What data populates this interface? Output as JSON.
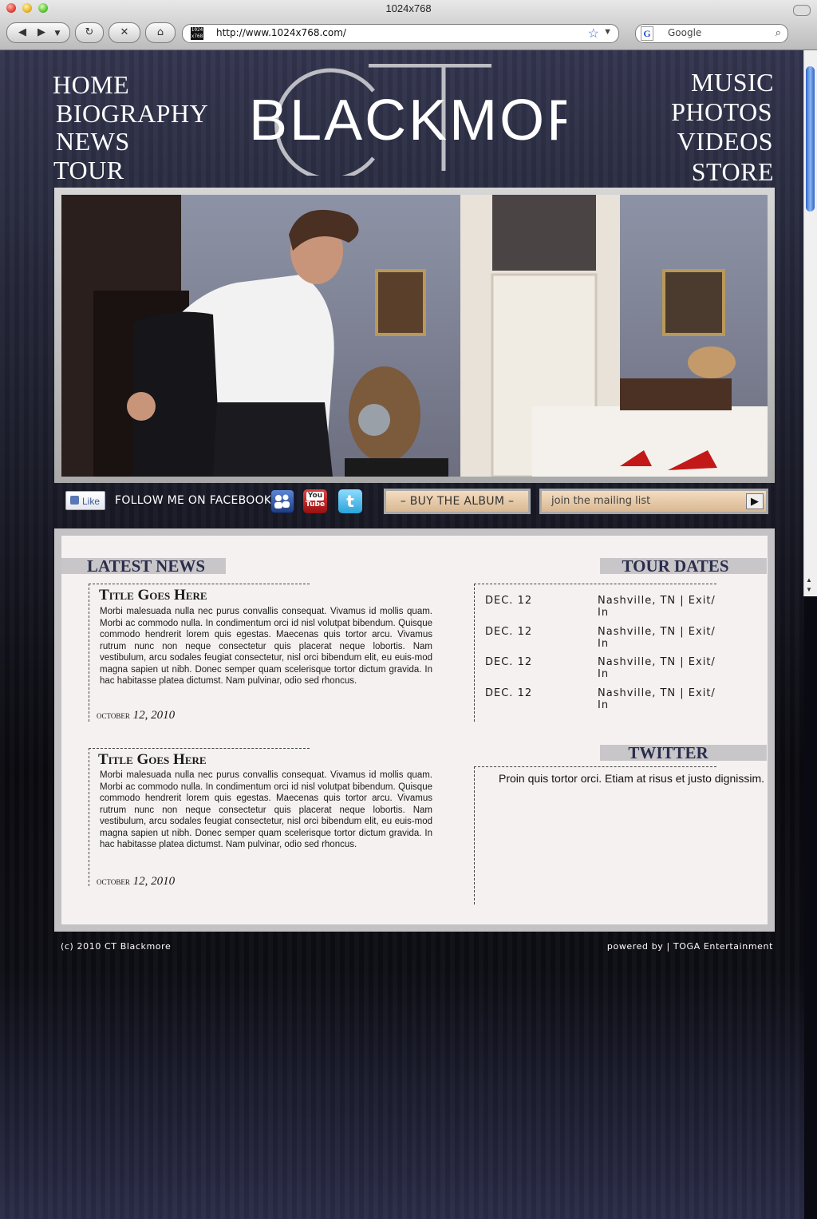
{
  "browser": {
    "window_title": "1024x768",
    "url": "http://www.1024x768.com/",
    "favicon_text": "1024 x768",
    "search_engine": "Google",
    "search_placeholder": "Google"
  },
  "nav": {
    "left": [
      "HOME",
      "BIOGRAPHY",
      "NEWS",
      "TOUR"
    ],
    "right": [
      "MUSIC",
      "PHOTOS",
      "VIDEOS",
      "STORE"
    ]
  },
  "logo": {
    "initials": "CT",
    "name": "BLACKMORE"
  },
  "social": {
    "like_label": "Like",
    "follow_text": "FOLLOW ME ON FACEBOOK",
    "youtube_label_top": "You",
    "youtube_label_bottom": "Tube",
    "album_button": "– BUY THE ALBUM –",
    "mailing_placeholder": "join the mailing list"
  },
  "news": {
    "heading": "LATEST NEWS",
    "posts": [
      {
        "title": "Title Goes Here",
        "body": "Morbi malesuada nulla nec purus convallis consequat. Vivamus id mollis quam. Morbi ac commodo nulla. In condimentum orci id nisl volutpat bibendum. Quisque commodo hendrerit lorem quis egestas. Maecenas quis tortor arcu. Vivamus rutrum nunc non neque consectetur quis placerat neque lobortis. Nam vestibulum, arcu sodales feugiat consectetur, nisl orci bibendum elit, eu euis-mod magna sapien ut nibh. Donec semper quam scelerisque tortor dictum gravida. In hac habitasse platea dictumst. Nam pulvinar, odio sed rhoncus.",
        "date_month": "october",
        "date_rest": "12, 2010"
      },
      {
        "title": "Title Goes Here",
        "body": "Morbi malesuada nulla nec purus convallis consequat. Vivamus id mollis quam. Morbi ac commodo nulla. In condimentum orci id nisl volutpat bibendum. Quisque commodo hendrerit lorem quis egestas. Maecenas quis tortor arcu. Vivamus rutrum nunc non neque consectetur quis placerat neque lobortis. Nam vestibulum, arcu sodales feugiat consectetur, nisl orci bibendum elit, eu euis-mod magna sapien ut nibh. Donec semper quam scelerisque tortor dictum gravida. In hac habitasse platea dictumst. Nam pulvinar, odio sed rhoncus.",
        "date_month": "october",
        "date_rest": "12, 2010"
      }
    ]
  },
  "tour": {
    "heading": "TOUR DATES",
    "dates": [
      {
        "date": "DEC. 12",
        "venue": "Nashville, TN | Exit/ In"
      },
      {
        "date": "DEC. 12",
        "venue": "Nashville, TN | Exit/ In"
      },
      {
        "date": "DEC. 12",
        "venue": "Nashville, TN | Exit/ In"
      },
      {
        "date": "DEC. 12",
        "venue": "Nashville, TN | Exit/ In"
      }
    ]
  },
  "twitter": {
    "heading": "TWITTER",
    "tweet": "Proin quis tortor orci. Etiam at risus et justo dignissim."
  },
  "footer": {
    "copyright": "(c) 2010 CT Blackmore",
    "powered_by": "powered by | TOGA Entertainment"
  },
  "colors": {
    "heading_text": "#2a2d4c",
    "tab_bg": "#c8c6c8",
    "panel_bg": "#f6f1f1",
    "button_bg": "#e8caa6"
  }
}
